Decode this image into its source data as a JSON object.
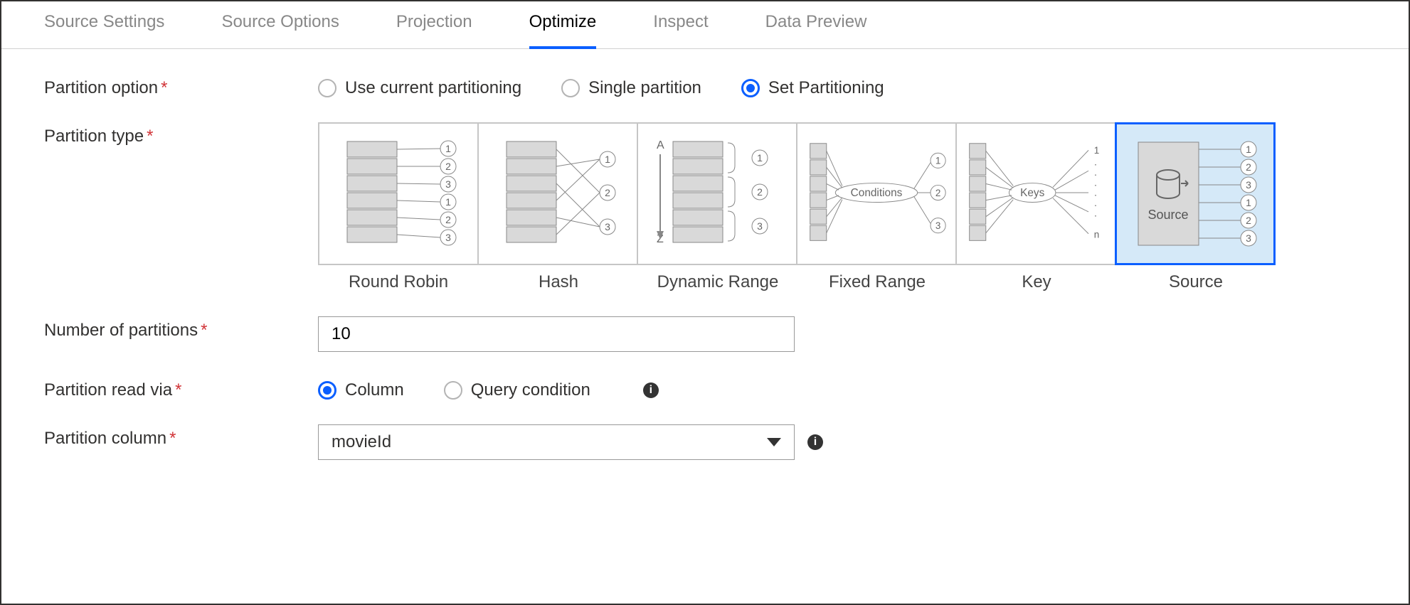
{
  "tabs": [
    {
      "label": "Source Settings",
      "active": false
    },
    {
      "label": "Source Options",
      "active": false
    },
    {
      "label": "Projection",
      "active": false
    },
    {
      "label": "Optimize",
      "active": true
    },
    {
      "label": "Inspect",
      "active": false
    },
    {
      "label": "Data Preview",
      "active": false
    }
  ],
  "labels": {
    "partition_option": "Partition option",
    "partition_type": "Partition type",
    "num_partitions": "Number of partitions",
    "read_via": "Partition read via",
    "partition_column": "Partition column"
  },
  "partition_option": {
    "options": [
      {
        "label": "Use current partitioning",
        "selected": false
      },
      {
        "label": "Single partition",
        "selected": false
      },
      {
        "label": "Set Partitioning",
        "selected": true
      }
    ]
  },
  "partition_types": [
    {
      "label": "Round Robin",
      "selected": false
    },
    {
      "label": "Hash",
      "selected": false
    },
    {
      "label": "Dynamic Range",
      "selected": false
    },
    {
      "label": "Fixed Range",
      "selected": false
    },
    {
      "label": "Key",
      "selected": false
    },
    {
      "label": "Source",
      "selected": true
    }
  ],
  "num_partitions_value": "10",
  "read_via": {
    "options": [
      {
        "label": "Column",
        "selected": true
      },
      {
        "label": "Query condition",
        "selected": false
      }
    ]
  },
  "partition_column_value": "movieId",
  "diagram_text": {
    "conditions": "Conditions",
    "keys": "Keys",
    "source": "Source"
  }
}
